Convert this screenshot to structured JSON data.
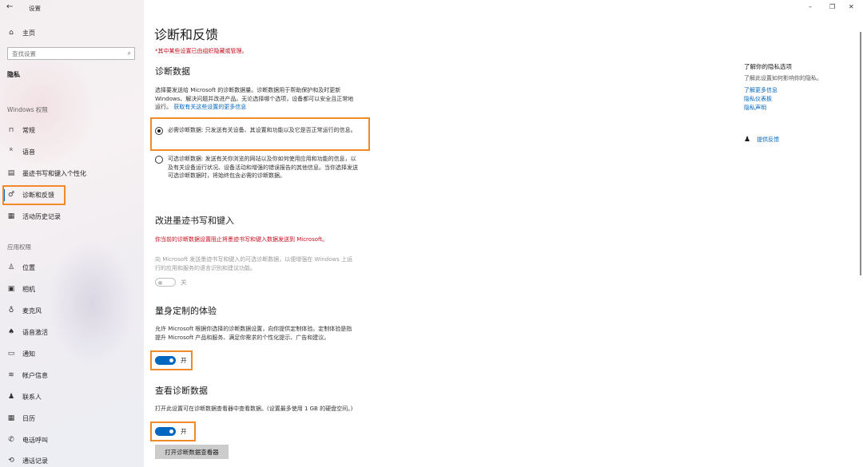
{
  "window": {
    "title": "设置",
    "back_glyph": "←",
    "minimize": "–",
    "restore": "❐",
    "close": "✕"
  },
  "sidebar": {
    "home": "主页",
    "search_placeholder": "查找设置",
    "section": "隐私",
    "windows_perms_header": "Windows 权限",
    "windows_items": [
      {
        "label": "常规",
        "icon": "lock-icon",
        "glyph": "🔒"
      },
      {
        "label": "语音",
        "icon": "speech-icon",
        "glyph": "ᴿ"
      },
      {
        "label": "墨迹书写和键入个性化",
        "icon": "notepad-icon",
        "glyph": "▤"
      },
      {
        "label": "诊断和反馈",
        "icon": "feedback-icon",
        "glyph": "♂"
      },
      {
        "label": "活动历史记录",
        "icon": "history-icon",
        "glyph": "▦"
      }
    ],
    "app_perms_header": "应用权限",
    "app_items": [
      {
        "label": "位置",
        "icon": "location-icon",
        "glyph": "♙"
      },
      {
        "label": "相机",
        "icon": "camera-icon",
        "glyph": "▣"
      },
      {
        "label": "麦克风",
        "icon": "microphone-icon",
        "glyph": "♁"
      },
      {
        "label": "语音激活",
        "icon": "voice-activation-icon",
        "glyph": "♠"
      },
      {
        "label": "通知",
        "icon": "notification-icon",
        "glyph": "▭"
      },
      {
        "label": "帐户信息",
        "icon": "account-info-icon",
        "glyph": "≋"
      },
      {
        "label": "联系人",
        "icon": "contacts-icon",
        "glyph": "♟"
      },
      {
        "label": "日历",
        "icon": "calendar-icon",
        "glyph": "▦"
      },
      {
        "label": "电话呼叫",
        "icon": "phone-icon",
        "glyph": "✆"
      },
      {
        "label": "通话记录",
        "icon": "call-history-icon",
        "glyph": "⟲"
      }
    ]
  },
  "main": {
    "title": "诊断和反馈",
    "org_note": "*其中某些设置已由组织隐藏或管理。",
    "diag": {
      "heading": "诊断数据",
      "desc": "选择要发送给 Microsoft 的诊断数据量。诊断数据用于帮助保护和及时更新 Windows、解决问题并改进产品。无论选择哪个选项，设备都可以安全且正常地运行。",
      "link": "获取有关这些设置的更多信息",
      "required": "必需诊断数据: 只发送有关设备、其设置和功能以及它是否正常运行的信息。",
      "optional": "可选诊断数据: 发送有关你浏览的网站以及你如何使用应用和功能的信息，以及有关设备运行状况、设备活动和增强的错误报告的其他信息。当你选择发送可选诊断数据时，将始终包含必需的诊断数据。"
    },
    "inking": {
      "heading": "改进墨迹书写和键入",
      "warning": "你当前的诊断数据设置阻止将墨迹书写和键入数据发送到 Microsoft。",
      "desc": "向 Microsoft 发送墨迹书写和键入的可选诊断数据，以便增强在 Windows 上运行的应用和服务的语言识别和建议功能。",
      "toggle_label": "关"
    },
    "tailored": {
      "heading": "量身定制的体验",
      "desc": "允许 Microsoft 根据你选择的诊断数据设置，向你提供定制体验。定制体验是指提升 Microsoft 产品和服务、满足你需求的个性化提示、广告和建议。",
      "toggle_label": "开"
    },
    "viewer": {
      "heading": "查看诊断数据",
      "desc": "打开此设置可在诊断数据查看器中查看数据。(设置最多使用 1 GB 的硬盘空间。)",
      "toggle_label": "开",
      "button": "打开诊断数据查看器"
    }
  },
  "right": {
    "heading": "了解你的隐私选项",
    "desc": "了解此设置如何影响你的隐私。",
    "links": [
      "了解更多信息",
      "隐私仪表板",
      "隐私声明"
    ],
    "feedback": "提供反馈"
  }
}
